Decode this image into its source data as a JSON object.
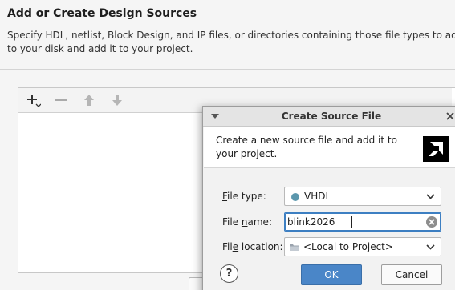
{
  "page": {
    "title": "Add or Create Design Sources",
    "description": "Specify HDL, netlist, Block Design, and IP files, or directories containing those file types to add to your disk and add it to your project."
  },
  "toolbar": {
    "icons": [
      "add-icon",
      "remove-icon",
      "move-up-icon",
      "move-down-icon"
    ]
  },
  "dialog": {
    "title": "Create Source File",
    "description": "Create a new source file and add it to your project.",
    "file_type": {
      "label_pre": "",
      "label_ul": "F",
      "label_post": "ile type:",
      "value": "VHDL",
      "dot_color": "#5b97ad"
    },
    "file_name": {
      "label_pre": "File ",
      "label_ul": "n",
      "label_post": "ame:",
      "value": "blink2026"
    },
    "file_location": {
      "label_pre": "Fil",
      "label_ul": "e",
      "label_post": " location:",
      "value": "<Local to Project>"
    },
    "help_label": "?",
    "ok_label": "OK",
    "cancel_label": "Cancel"
  },
  "colors": {
    "accent": "#4a86c8",
    "focus_border": "#3d7fc2",
    "vhdl_dot": "#5b97ad"
  }
}
